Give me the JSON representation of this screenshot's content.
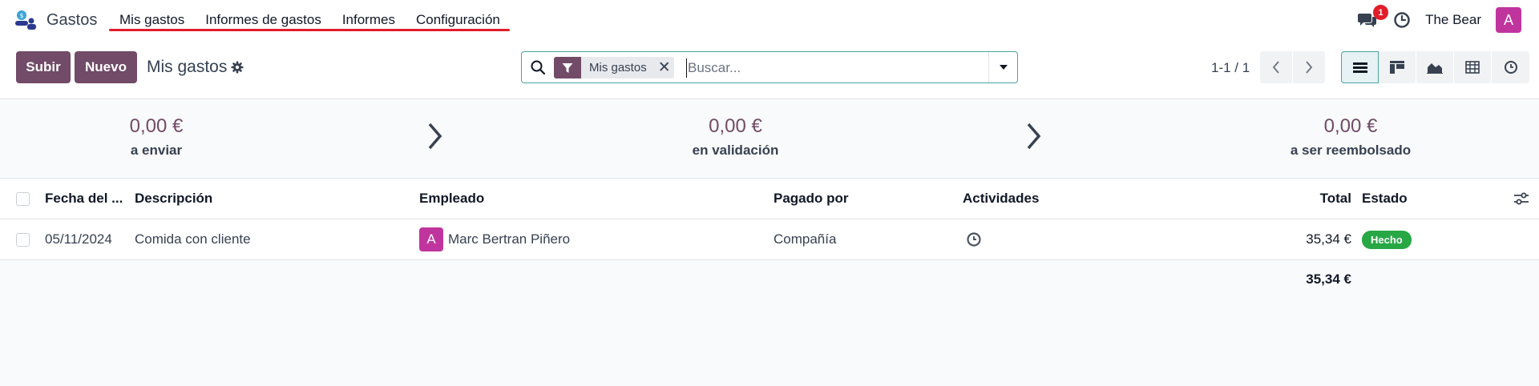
{
  "app": {
    "name": "Gastos"
  },
  "menu": {
    "items": [
      {
        "label": "Mis gastos"
      },
      {
        "label": "Informes de gastos"
      },
      {
        "label": "Informes"
      },
      {
        "label": "Configuración"
      }
    ]
  },
  "topbar": {
    "messages_count": "1",
    "user_name": "The Bear",
    "user_initial": "A"
  },
  "toolbar": {
    "upload_label": "Subir",
    "new_label": "Nuevo",
    "title": "Mis gastos"
  },
  "search": {
    "facet_label": "Mis gastos",
    "placeholder": "Buscar..."
  },
  "pager": {
    "value": "1-1 / 1"
  },
  "summary": [
    {
      "amount": "0,00 €",
      "label": "a enviar"
    },
    {
      "amount": "0,00 €",
      "label": "en validación"
    },
    {
      "amount": "0,00 €",
      "label": "a ser reembolsado"
    }
  ],
  "table": {
    "headers": {
      "date": "Fecha del ...",
      "description": "Descripción",
      "employee": "Empleado",
      "paid_by": "Pagado por",
      "activities": "Actividades",
      "total": "Total",
      "status": "Estado"
    },
    "rows": [
      {
        "date": "05/11/2024",
        "description": "Comida con cliente",
        "employee_initial": "A",
        "employee": "Marc Bertran Piñero",
        "paid_by": "Compañía",
        "total": "35,34 €",
        "status": "Hecho"
      }
    ],
    "footer_total": "35,34 €"
  },
  "colors": {
    "brand": "#714b67",
    "accent": "#4aa3a2",
    "success": "#28a745",
    "avatar": "#c0349e",
    "notice": "#e11d2a"
  }
}
